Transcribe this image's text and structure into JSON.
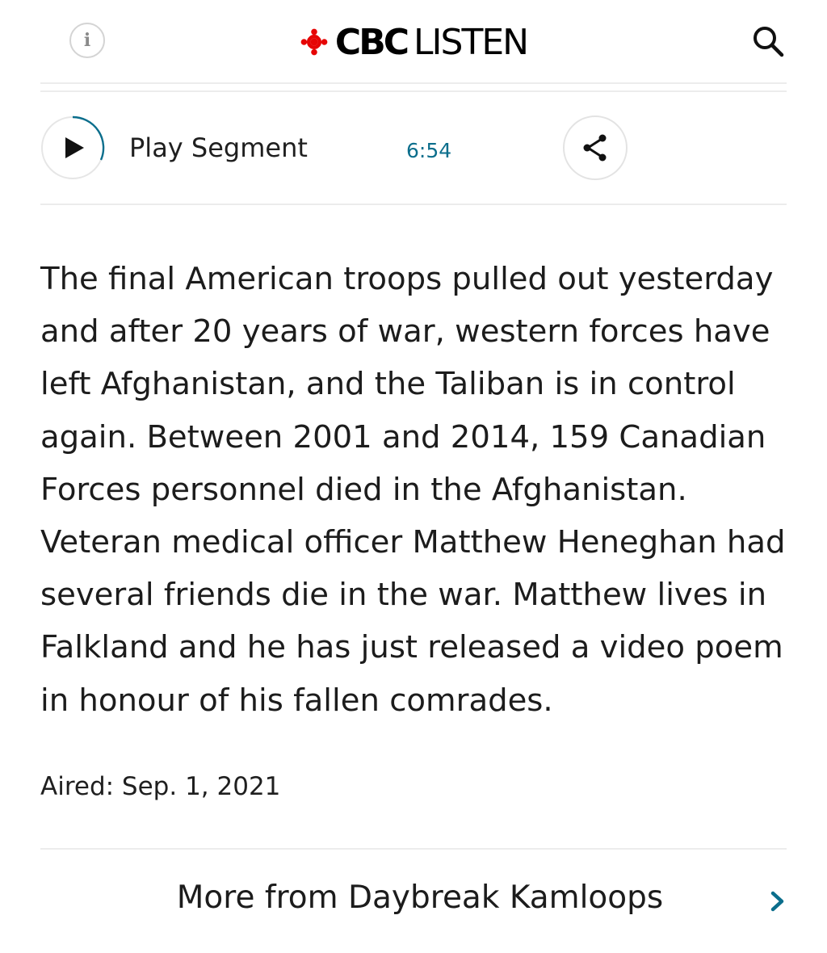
{
  "header": {
    "info_icon_glyph": "i",
    "logo_bold": "CBC",
    "logo_light": "LISTEN",
    "brand_color": "#e60505"
  },
  "player": {
    "play_label": "Play Segment",
    "duration": "6:54",
    "accent_color": "#0b6e8c"
  },
  "description": "The final American troops pulled out yesterday and after 20 years of war, western forces have left Afghanistan, and the Taliban is in control again. Between 2001 and 2014, 159 Canadian Forces personnel died in the Afghanistan. Veteran medical officer Matthew Heneghan had several friends die in the war. Matthew lives in Falkland and he has just released a video poem in honour of his fallen comrades.",
  "aired": "Aired: Sep. 1, 2021",
  "more": {
    "label": "More from Daybreak Kamloops"
  },
  "icons": {
    "info": "info-icon",
    "search": "search-icon",
    "play": "play-icon",
    "share": "share-icon",
    "chevron": "chevron-right-icon"
  }
}
